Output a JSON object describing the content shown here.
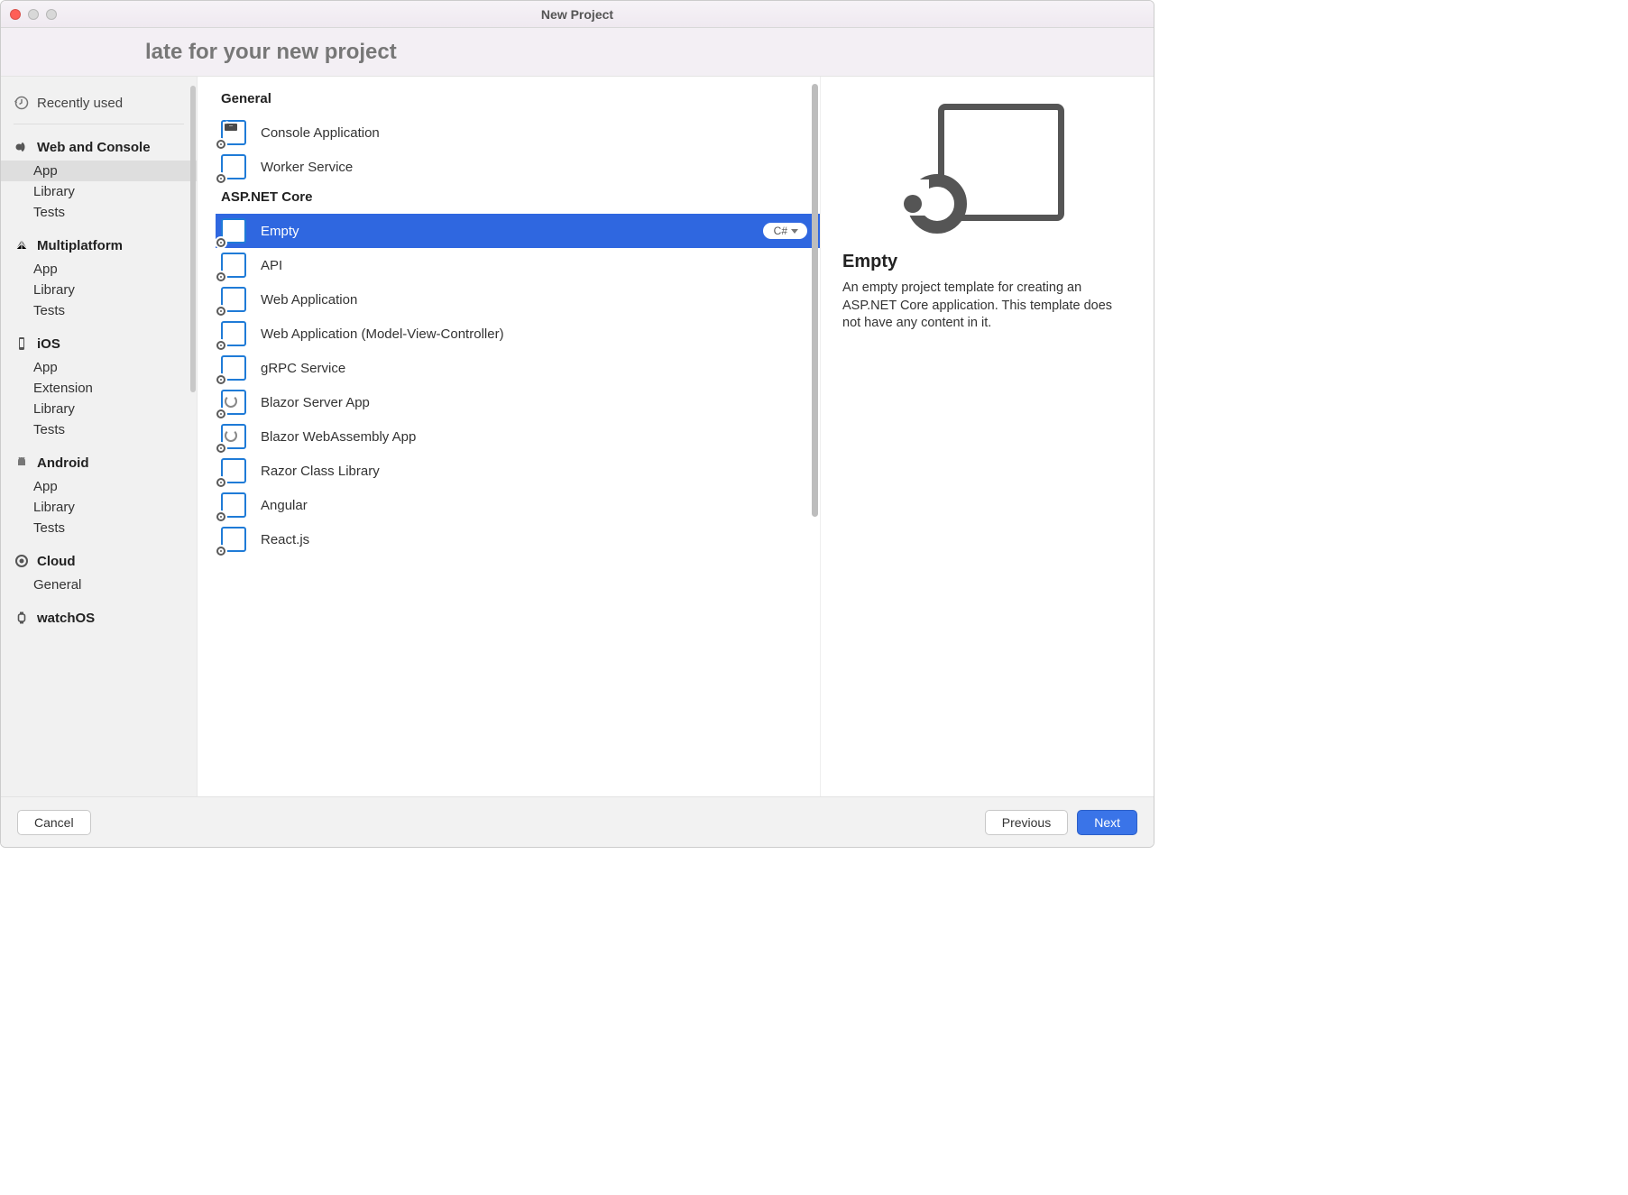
{
  "window": {
    "title": "New Project"
  },
  "header": {
    "text": "late for your new project"
  },
  "sidebar": {
    "recent_label": "Recently used",
    "groups": [
      {
        "title": "Web and Console",
        "items": [
          "App",
          "Library",
          "Tests"
        ],
        "selected": "App"
      },
      {
        "title": "Multiplatform",
        "items": [
          "App",
          "Library",
          "Tests"
        ]
      },
      {
        "title": "iOS",
        "items": [
          "App",
          "Extension",
          "Library",
          "Tests"
        ]
      },
      {
        "title": "Android",
        "items": [
          "App",
          "Library",
          "Tests"
        ]
      },
      {
        "title": "Cloud",
        "items": [
          "General"
        ]
      },
      {
        "title": "watchOS",
        "items": []
      }
    ]
  },
  "templates": {
    "groups": [
      {
        "title": "General",
        "items": [
          {
            "label": "Console Application",
            "icon": "console"
          },
          {
            "label": "Worker Service",
            "icon": "box"
          }
        ]
      },
      {
        "title": "ASP.NET Core",
        "items": [
          {
            "label": "Empty",
            "icon": "box",
            "selected": true,
            "language": "C#"
          },
          {
            "label": "API",
            "icon": "box"
          },
          {
            "label": "Web Application",
            "icon": "box"
          },
          {
            "label": "Web Application (Model-View-Controller)",
            "icon": "box"
          },
          {
            "label": "gRPC Service",
            "icon": "box"
          },
          {
            "label": "Blazor Server App",
            "icon": "swirl"
          },
          {
            "label": "Blazor WebAssembly App",
            "icon": "swirl"
          },
          {
            "label": "Razor Class Library",
            "icon": "box"
          },
          {
            "label": "Angular",
            "icon": "box"
          },
          {
            "label": "React.js",
            "icon": "box"
          }
        ]
      }
    ]
  },
  "details": {
    "title": "Empty",
    "description": "An empty project template for creating an ASP.NET Core application. This template does not have any content in it."
  },
  "footer": {
    "cancel": "Cancel",
    "previous": "Previous",
    "next": "Next"
  }
}
